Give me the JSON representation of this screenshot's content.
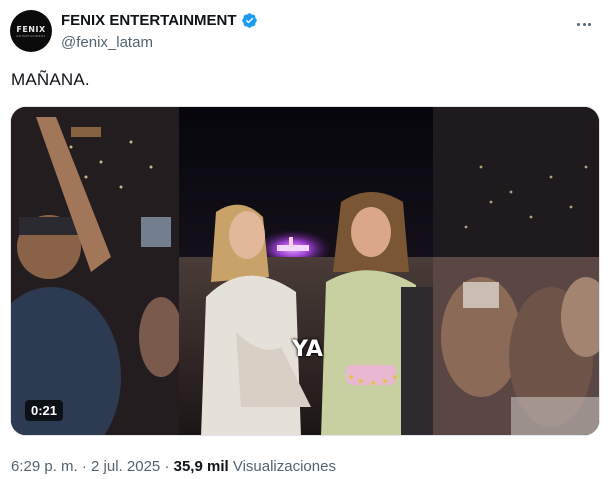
{
  "author": {
    "avatar_logo": "FENIX",
    "avatar_sub": "ENTERTAINMENT",
    "display_name": "FENIX ENTERTAINMENT",
    "handle": "@fenix_latam",
    "verified": true,
    "verified_color": "#1d9bf0"
  },
  "tweet": {
    "text": "MAÑANA."
  },
  "media": {
    "caption": "YA",
    "duration": "0:21"
  },
  "meta": {
    "time": "6:29 p. m.",
    "separator": "·",
    "date": "2 jul. 2025",
    "views_count": "35,9 mil",
    "views_label": "Visualizaciones"
  },
  "icons": {
    "more": "more-horizontal-icon",
    "verified": "verified-badge-icon"
  }
}
